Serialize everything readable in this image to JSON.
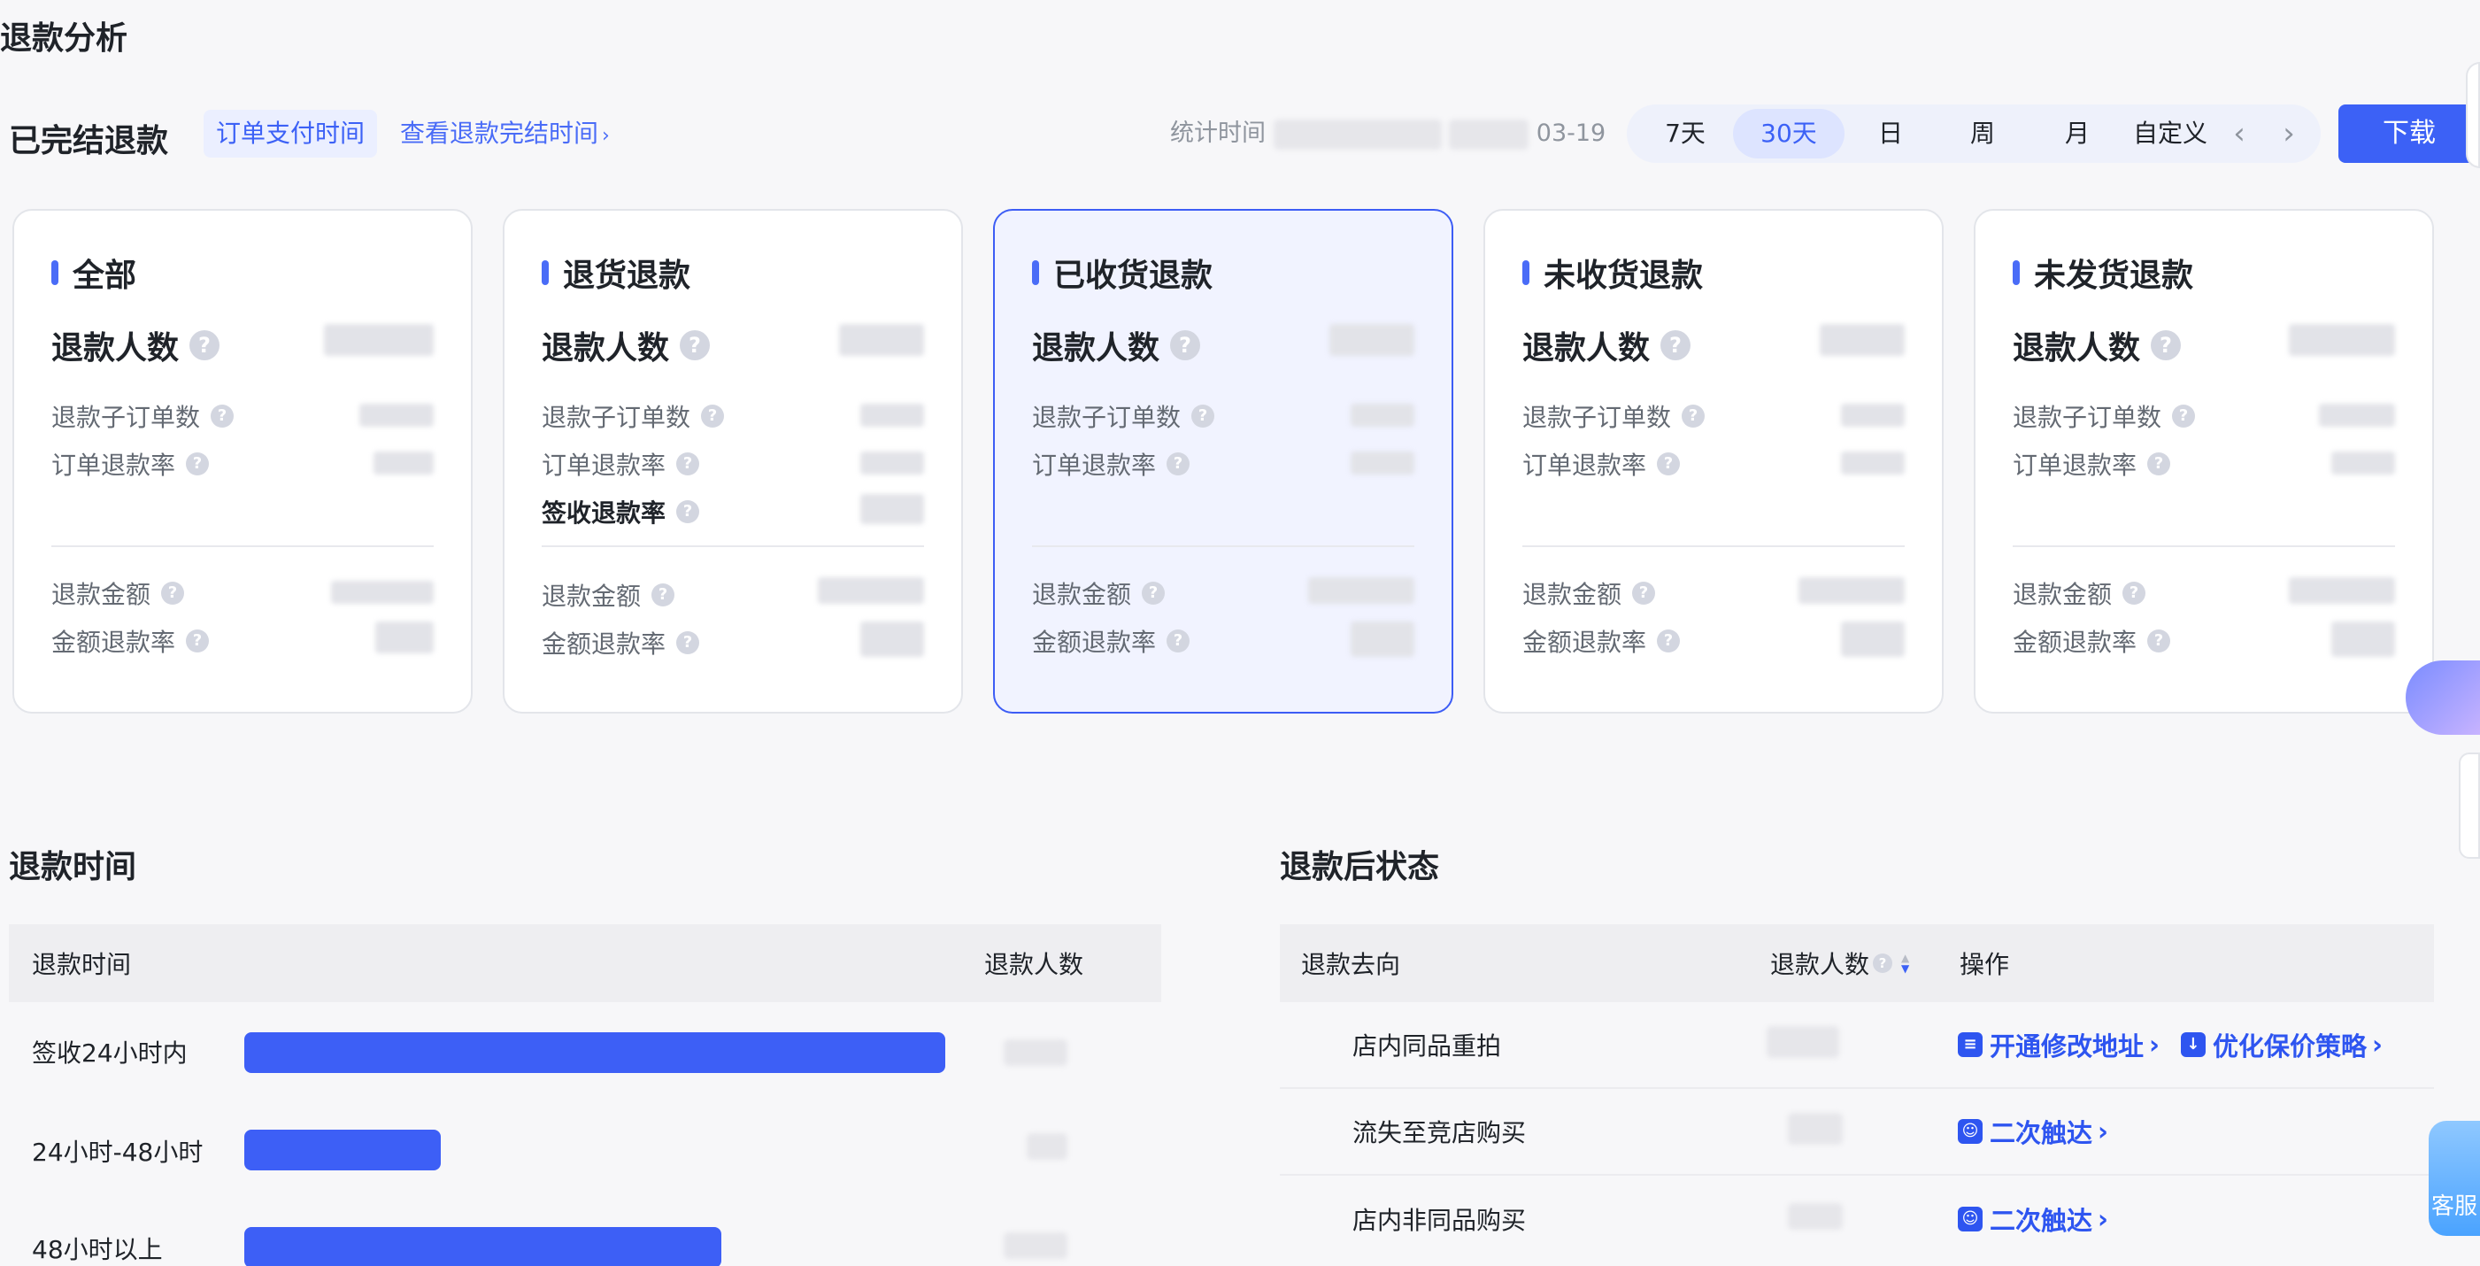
{
  "page": {
    "title": "退款分析"
  },
  "summary": {
    "title": "已完结退款",
    "active_filter": "订单支付时间",
    "view_link": "查看退款完结时间",
    "stat_time_label": "统计时间",
    "stat_time_end": "03-19",
    "ranges": [
      "7天",
      "30天",
      "日",
      "周",
      "月",
      "自定义"
    ],
    "active_range": "30天",
    "download_label": "下载"
  },
  "cards": [
    {
      "title": "全部",
      "big_metric": "退款人数",
      "metrics": [
        "退款子订单数",
        "订单退款率"
      ],
      "money_metrics": [
        "退款金额",
        "金额退款率"
      ]
    },
    {
      "title": "退货退款",
      "big_metric": "退款人数",
      "metrics": [
        "退款子订单数",
        "订单退款率",
        "签收退款率"
      ],
      "money_metrics": [
        "退款金额",
        "金额退款率"
      ]
    },
    {
      "title": "已收货退款",
      "big_metric": "退款人数",
      "metrics": [
        "退款子订单数",
        "订单退款率"
      ],
      "money_metrics": [
        "退款金额",
        "金额退款率"
      ]
    },
    {
      "title": "未收货退款",
      "big_metric": "退款人数",
      "metrics": [
        "退款子订单数",
        "订单退款率"
      ],
      "money_metrics": [
        "退款金额",
        "金额退款率"
      ]
    },
    {
      "title": "未发货退款",
      "big_metric": "退款人数",
      "metrics": [
        "退款子订单数",
        "订单退款率"
      ],
      "money_metrics": [
        "退款金额",
        "金额退款率"
      ]
    }
  ],
  "refund_time": {
    "title": "退款时间",
    "col_time": "退款时间",
    "col_count": "退款人数",
    "rows": [
      {
        "label": "签收24小时内",
        "share": 1.0
      },
      {
        "label": "24小时-48小时",
        "share": 0.28
      },
      {
        "label": "48小时以上",
        "share": 0.68
      }
    ]
  },
  "after_status": {
    "title": "退款后状态",
    "col_direction": "退款去向",
    "col_count": "退款人数",
    "col_action": "操作",
    "rows": [
      {
        "label": "店内同品重拍",
        "actions": [
          "开通修改地址",
          "优化保价策略"
        ]
      },
      {
        "label": "流失至竞店购买",
        "actions": [
          "二次触达"
        ]
      },
      {
        "label": "店内非同品购买",
        "actions": [
          "二次触达"
        ]
      }
    ]
  },
  "side": {
    "service_label": "客服"
  }
}
